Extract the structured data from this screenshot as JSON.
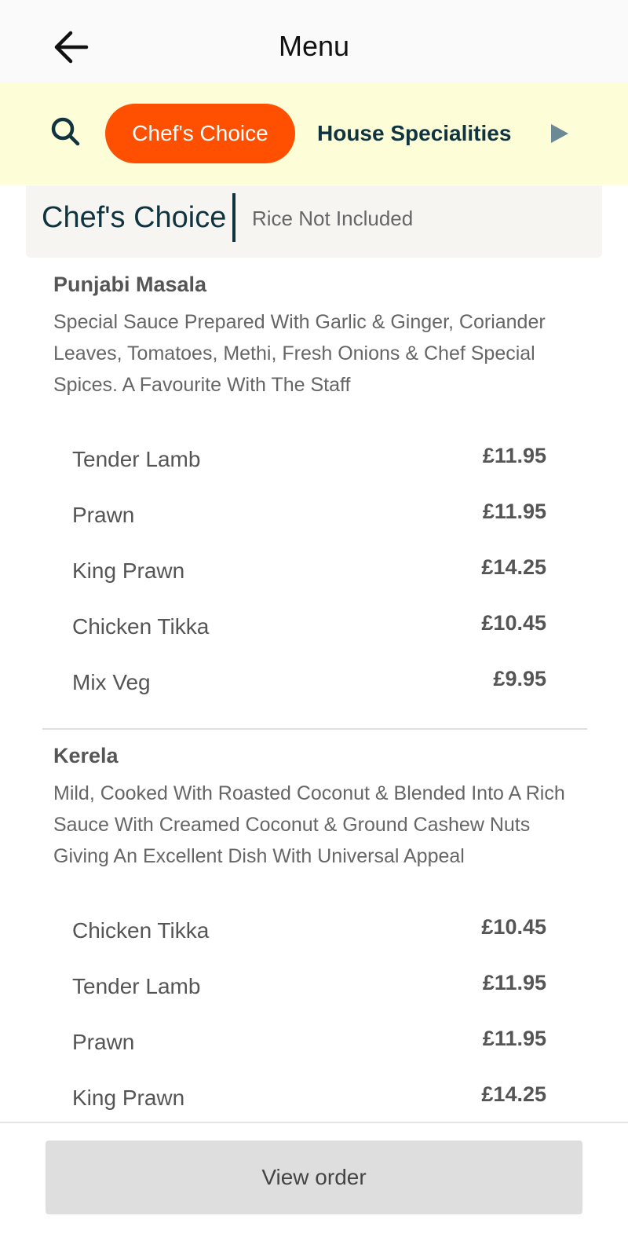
{
  "header": {
    "title": "Menu",
    "back_icon": "arrow-left-icon"
  },
  "categories": {
    "search_icon": "search-icon",
    "tabs": [
      {
        "label": "Chef's Choice",
        "active": true
      },
      {
        "label": "House Specialities",
        "active": false
      }
    ],
    "next_icon": "play-right-icon"
  },
  "section": {
    "title": "Chef's Choice",
    "note": "Rice Not Included"
  },
  "dishes": [
    {
      "name": "Punjabi Masala",
      "description": "Special Sauce Prepared With Garlic & Ginger, Coriander Leaves, Tomatoes, Methi, Fresh Onions & Chef Special Spices. A Favourite With The Staff",
      "options": [
        {
          "name": "Tender Lamb",
          "price": "£11.95"
        },
        {
          "name": "Prawn",
          "price": "£11.95"
        },
        {
          "name": "King Prawn",
          "price": "£14.25"
        },
        {
          "name": "Chicken Tikka",
          "price": "£10.45"
        },
        {
          "name": "Mix Veg",
          "price": "£9.95"
        }
      ]
    },
    {
      "name": "Kerela",
      "description": "Mild, Cooked With Roasted Coconut & Blended Into A Rich Sauce With Creamed Coconut & Ground Cashew Nuts Giving An Excellent Dish With Universal Appeal",
      "options": [
        {
          "name": "Chicken Tikka",
          "price": "£10.45"
        },
        {
          "name": "Tender Lamb",
          "price": "£11.95"
        },
        {
          "name": "Prawn",
          "price": "£11.95"
        },
        {
          "name": "King Prawn",
          "price": "£14.25"
        }
      ]
    }
  ],
  "footer": {
    "view_order_label": "View order"
  },
  "colors": {
    "accent": "#fe5000",
    "brand_dark": "#0f3440",
    "category_bar": "#fdfdd8"
  }
}
